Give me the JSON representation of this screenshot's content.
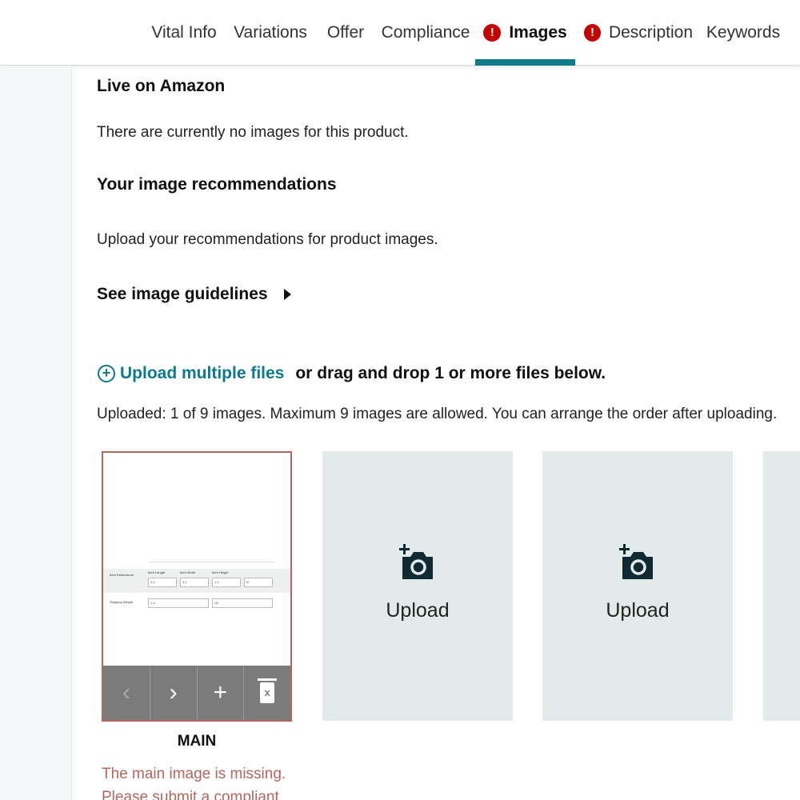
{
  "tabs": [
    {
      "label": "Vital Info",
      "error": false,
      "active": false
    },
    {
      "label": "Variations",
      "error": false,
      "active": false
    },
    {
      "label": "Offer",
      "error": false,
      "active": false
    },
    {
      "label": "Compliance",
      "error": false,
      "active": false
    },
    {
      "label": "Images",
      "error": true,
      "active": true
    },
    {
      "label": "Description",
      "error": true,
      "active": false
    },
    {
      "label": "Keywords",
      "error": false,
      "active": false
    }
  ],
  "error_glyph": "!",
  "live": {
    "heading": "Live on Amazon",
    "text": "There are currently no images for this product."
  },
  "recommendations": {
    "heading": "Your image recommendations",
    "text": "Upload your recommendations for product images.",
    "guidelines_link": "See image guidelines"
  },
  "upload": {
    "plus_icon": "+",
    "link": "Upload multiple files",
    "rest": "or drag and drop 1 or more files below.",
    "status": "Uploaded: 1 of 9 images. Maximum 9 images are allowed. You can arrange the order after uploading."
  },
  "main_image": {
    "label": "MAIN",
    "error": "The main image is missing. Please submit a compliant image to lift",
    "thumbnail": {
      "row1_label": "Item Dimensions",
      "col_length": "Item Length",
      "col_width": "Item Width",
      "col_height": "Item Height",
      "v_length": "4.5",
      "v_width": "3.2",
      "v_height": "1.9",
      "unit1": "In",
      "row2_label": "Shipping Weight",
      "v_weight": "1.4",
      "unit2": "LB"
    },
    "controls": {
      "prev": "‹",
      "next": "›",
      "add": "+",
      "delete_mark": "x"
    }
  },
  "slots": [
    {
      "label": "Upload"
    },
    {
      "label": "Upload"
    }
  ],
  "colors": {
    "accent": "#0b7b8b",
    "error": "#c40000",
    "error_text": "#b2665f",
    "slot_bg": "#e3eaea"
  }
}
